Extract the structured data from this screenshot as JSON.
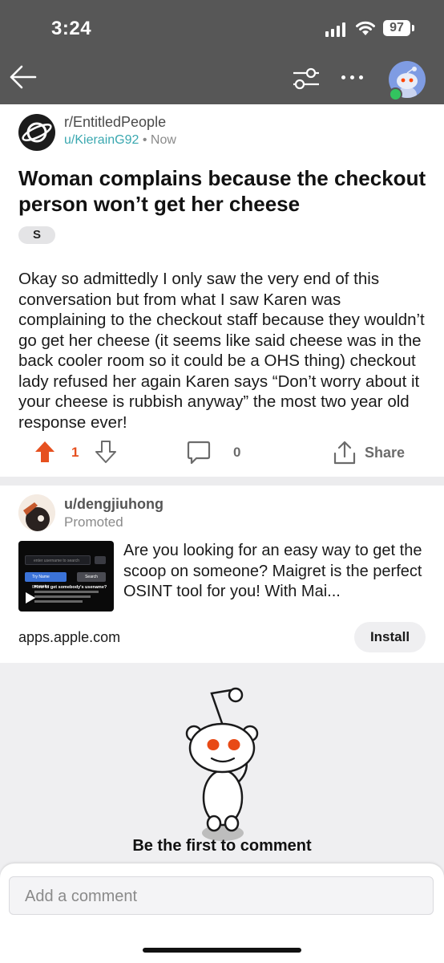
{
  "status_bar": {
    "time": "3:24",
    "battery": "97"
  },
  "post": {
    "subreddit": "r/EntitledPeople",
    "author": "u/KierainG92",
    "separator": "•",
    "age": "Now",
    "title": "Woman complains because the checkout person won’t get her cheese",
    "flair": "S",
    "body": "Okay so admittedly I only saw the very end of this conversation but from what I saw Karen was complaining to the checkout staff because they wouldn’t go get her cheese (it seems like said cheese was in the back cooler room so it could be a OHS thing) checkout lady refused her again Karen says “Don’t worry about it your cheese is rubbish anyway” the most two year old response ever!",
    "votes": "1",
    "comments": "0",
    "share_label": "Share"
  },
  "ad": {
    "user": "u/dengjiuhong",
    "promoted": "Promoted",
    "text": "Are you looking for an easy way to get the scoop on someone? Maigret is the perfect OSINT tool for you! With Mai...",
    "domain": "apps.apple.com",
    "install_label": "Install",
    "thumb": {
      "search_placeholder": "enter username to search",
      "try_label": "Try Name generator",
      "search_label": "Search",
      "headline": "How to get somebody's usename?"
    }
  },
  "empty_comments": "Be the first to comment",
  "comment_input": {
    "placeholder": "Add a comment"
  },
  "colors": {
    "header": "#575757",
    "upvote": "#e6501f",
    "username": "#3aa8b0",
    "page_bg": "#efeff1"
  }
}
